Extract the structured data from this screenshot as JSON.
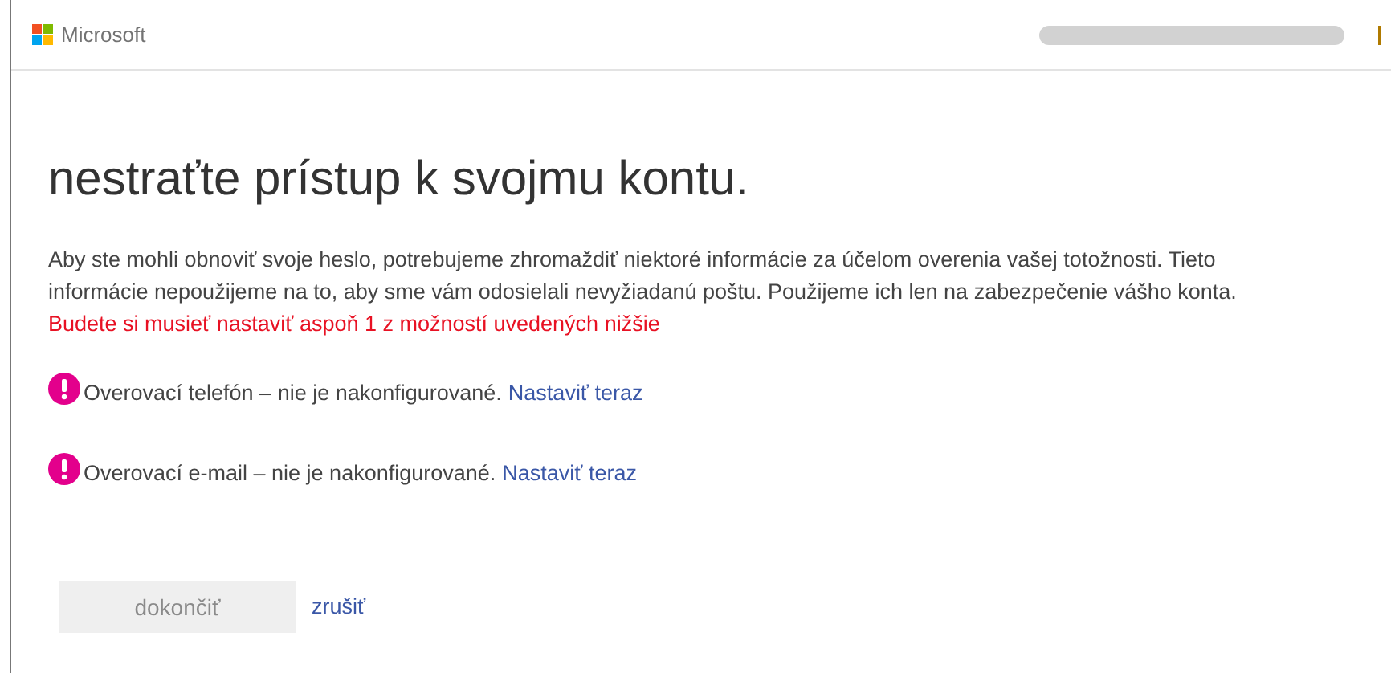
{
  "header": {
    "brand": "Microsoft"
  },
  "title": "nestraťte prístup k svojmu kontu.",
  "intro": "Aby ste mohli obnoviť svoje heslo, potrebujeme zhromaždiť niektoré informácie za účelom overenia vašej totožnosti. Tieto informácie nepoužijeme na to, aby sme vám odosielali nevyžiadanú poštu. Použijeme ich len na zabezpečenie vášho konta.",
  "warning": "Budete si musieť nastaviť aspoň 1 z možností uvedených nižšie",
  "methods": [
    {
      "text": "Overovací telefón – nie je nakonfigurované.",
      "link": "Nastaviť teraz"
    },
    {
      "text": "Overovací e-mail – nie je nakonfigurované.",
      "link": "Nastaviť teraz"
    }
  ],
  "finish_button": {
    "label": "dokončiť",
    "disabled": true
  },
  "cancel_link": "zrušiť"
}
